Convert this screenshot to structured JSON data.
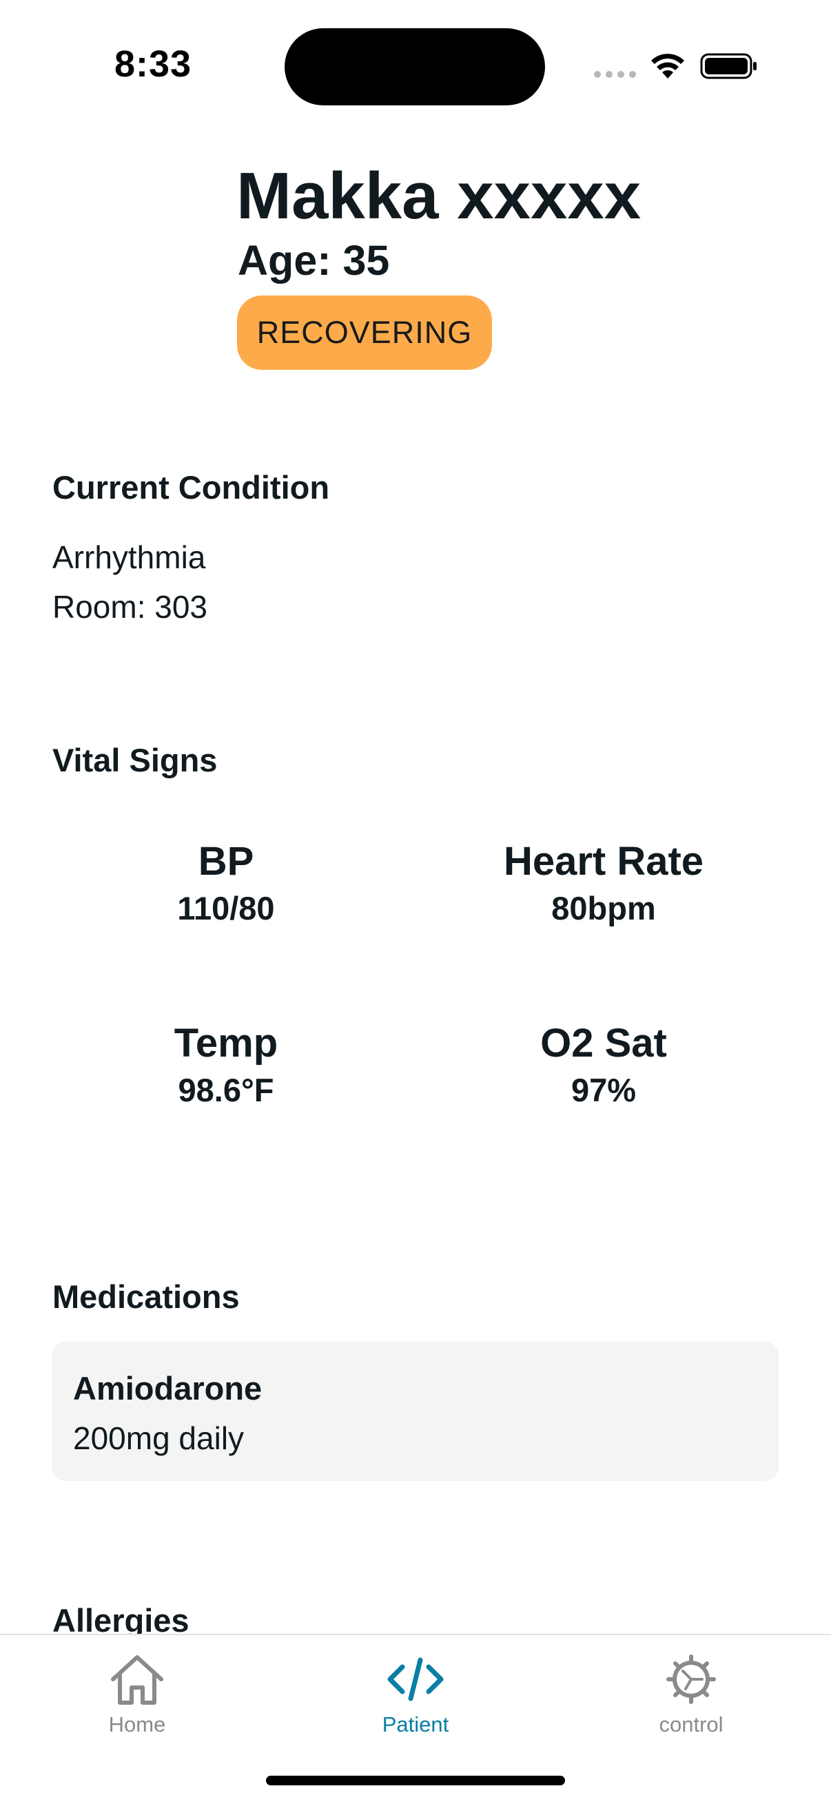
{
  "status_bar": {
    "time": "8:33"
  },
  "patient": {
    "name": "Makka xxxxx",
    "age": "Age: 35",
    "status": "RECOVERING",
    "status_color": "#fdab4a"
  },
  "condition": {
    "title": "Current Condition",
    "diagnosis": "Arrhythmia",
    "room": "Room: 303"
  },
  "vitals": {
    "title": "Vital Signs",
    "items": [
      {
        "label": "BP",
        "value": "110/80"
      },
      {
        "label": "Heart Rate",
        "value": "80bpm"
      },
      {
        "label": "Temp",
        "value": "98.6°F"
      },
      {
        "label": "O2 Sat",
        "value": "97%"
      }
    ]
  },
  "medications": {
    "title": "Medications",
    "items": [
      {
        "name": "Amiodarone",
        "dose": "200mg daily"
      }
    ]
  },
  "allergies": {
    "title": "Allergies"
  },
  "tab_bar": {
    "accent_color": "#0a7ea4",
    "inactive_color": "#8a8a8a",
    "tabs": [
      {
        "label": "Home",
        "icon": "house-icon",
        "active": false
      },
      {
        "label": "Patient",
        "icon": "code-icon",
        "active": true
      },
      {
        "label": "control",
        "icon": "gear-icon",
        "active": false
      }
    ]
  }
}
